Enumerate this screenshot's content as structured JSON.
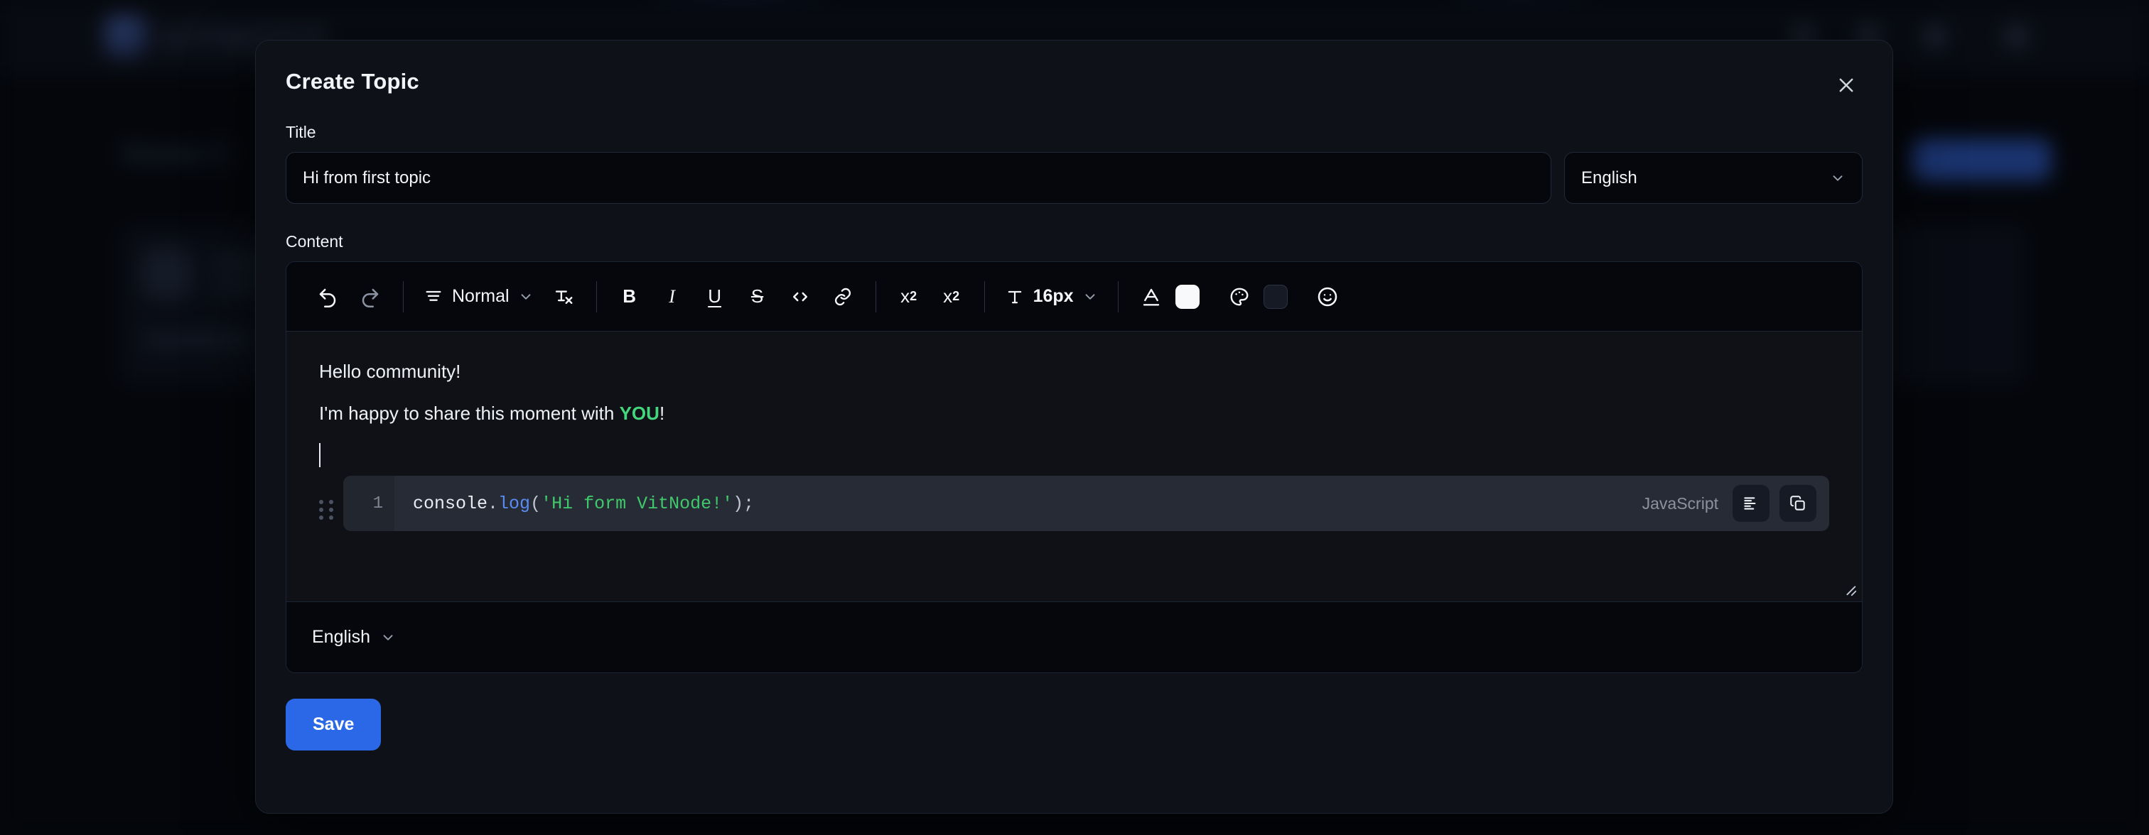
{
  "backdrop": {
    "logo_text": "VITNODE",
    "page_title": "Home C",
    "accent": "#2a68e8"
  },
  "modal": {
    "title": "Create Topic",
    "close_icon": "close-icon"
  },
  "title_field": {
    "label": "Title",
    "value": "Hi from first topic",
    "placeholder": "Title"
  },
  "language_select": {
    "value": "English",
    "chevron_icon": "chevron-down-icon"
  },
  "content_field": {
    "label": "Content"
  },
  "toolbar": {
    "undo": {
      "name": "undo-icon",
      "state": "enabled"
    },
    "redo": {
      "name": "redo-icon",
      "state": "disabled"
    },
    "paragraph": {
      "icon": "text-align-icon",
      "label": "Normal",
      "chevron_icon": "chevron-down-icon"
    },
    "clear_format": {
      "name": "clear-formatting-icon",
      "label": "Tx"
    },
    "bold": {
      "name": "bold-icon",
      "label": "B"
    },
    "italic": {
      "name": "italic-icon",
      "label": "I"
    },
    "underline": {
      "name": "underline-icon",
      "label": "U"
    },
    "strike": {
      "name": "strikethrough-icon",
      "label": "S"
    },
    "code": {
      "name": "code-icon",
      "label": "<>"
    },
    "link": {
      "name": "link-icon"
    },
    "superscript": {
      "name": "superscript-icon",
      "label": "x2"
    },
    "subscript": {
      "name": "subscript-icon",
      "label": "x2"
    },
    "font_size": {
      "icon": "font-size-icon",
      "label": "16px",
      "chevron_icon": "chevron-down-icon"
    },
    "text_color": {
      "icon": "text-color-icon",
      "swatch": "#f7f9fb"
    },
    "highlight_color": {
      "icon": "palette-icon",
      "swatch": "#151a24"
    },
    "emoji": {
      "name": "emoji-icon"
    }
  },
  "content_body": {
    "paragraphs": [
      {
        "text": "Hello community!"
      }
    ],
    "line2": {
      "prefix": "I'm happy to share this moment with ",
      "highlight": "YOU",
      "suffix": "!",
      "highlight_color": "#43d67c"
    },
    "code_block": {
      "line_number": "1",
      "language": "JavaScript",
      "tokens": {
        "object": "console",
        "dot": ".",
        "method": "log",
        "open_paren": "(",
        "string": "'Hi form VitNode!'",
        "close": ");"
      },
      "full_code": "console.log('Hi form VitNode!');",
      "format_icon": "code-format-icon",
      "copy_icon": "copy-icon",
      "grip_icon": "drag-handle-icon"
    },
    "resize_handle_icon": "resize-handle-icon"
  },
  "editor_footer": {
    "language": "English",
    "chevron_icon": "chevron-down-icon"
  },
  "save_button": {
    "label": "Save",
    "color": "#2a68e8"
  }
}
